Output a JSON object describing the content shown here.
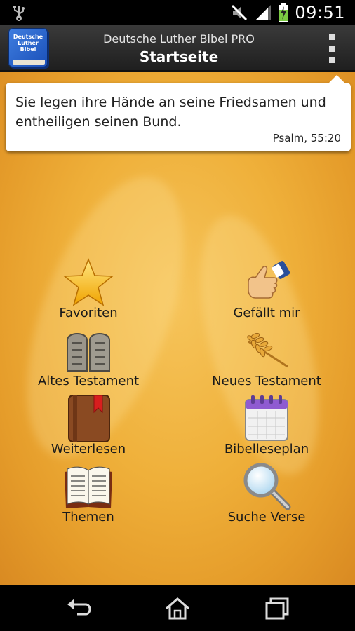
{
  "status_bar": {
    "time": "09:51",
    "icons": [
      "usb-icon",
      "mute-icon",
      "signal-icon",
      "battery-charging-icon"
    ]
  },
  "action_bar": {
    "logo_text": "Deutsche Luther Bibel",
    "subtitle": "Deutsche Luther Bibel PRO",
    "title": "Startseite",
    "menu_icon": "overflow-menu-icon"
  },
  "verse": {
    "text": "Sie legen ihre Hände an seine Friedsamen und entheiligen seinen Bund.",
    "reference": "Psalm, 55:20"
  },
  "menu": [
    {
      "label": "Favoriten",
      "icon": "star-icon"
    },
    {
      "label": "Gefällt mir",
      "icon": "thumbs-up-icon"
    },
    {
      "label": "Altes Testament",
      "icon": "stone-tablets-icon"
    },
    {
      "label": "Neues Testament",
      "icon": "wheat-icon"
    },
    {
      "label": "Weiterlesen",
      "icon": "bookmark-book-icon"
    },
    {
      "label": "Bibelleseplan",
      "icon": "calendar-icon"
    },
    {
      "label": "Themen",
      "icon": "open-book-icon"
    },
    {
      "label": "Suche Verse",
      "icon": "magnifier-icon"
    }
  ],
  "nav_bar": {
    "icons": [
      "back-icon",
      "home-icon",
      "recent-apps-icon"
    ]
  }
}
